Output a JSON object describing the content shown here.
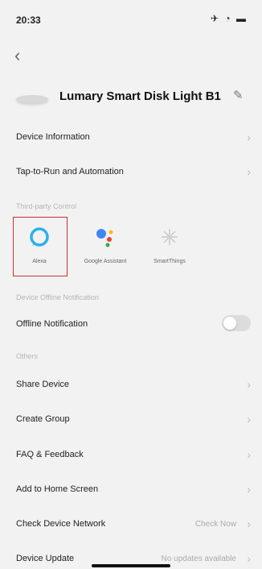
{
  "status_bar": {
    "time": "20:33",
    "icons": "✈ ◔ ▬"
  },
  "header": {
    "back_glyph": "‹",
    "device_name": "Lumary Smart Disk Light B1",
    "edit_glyph": "✎"
  },
  "rows": {
    "device_information": "Device Information",
    "tap_to_run": "Tap-to-Run and Automation",
    "offline_notification": "Offline Notification",
    "share_device": "Share Device",
    "create_group": "Create Group",
    "faq_feedback": "FAQ & Feedback",
    "add_home_screen": "Add to Home Screen",
    "check_network": "Check Device Network",
    "check_network_value": "Check Now",
    "device_update": "Device Update",
    "device_update_value": "No updates available"
  },
  "sections": {
    "third_party": "Third-party Control",
    "offline_notice": "Device Offline Notification",
    "others": "Others"
  },
  "third_party": [
    {
      "name": "Alexa",
      "icon": "alexa-icon"
    },
    {
      "name": "Google Assistant",
      "icon": "google-assistant-icon"
    },
    {
      "name": "SmartThings",
      "icon": "smartthings-icon"
    }
  ],
  "toggle": {
    "offline_notification_on": false
  },
  "chevron": "›"
}
